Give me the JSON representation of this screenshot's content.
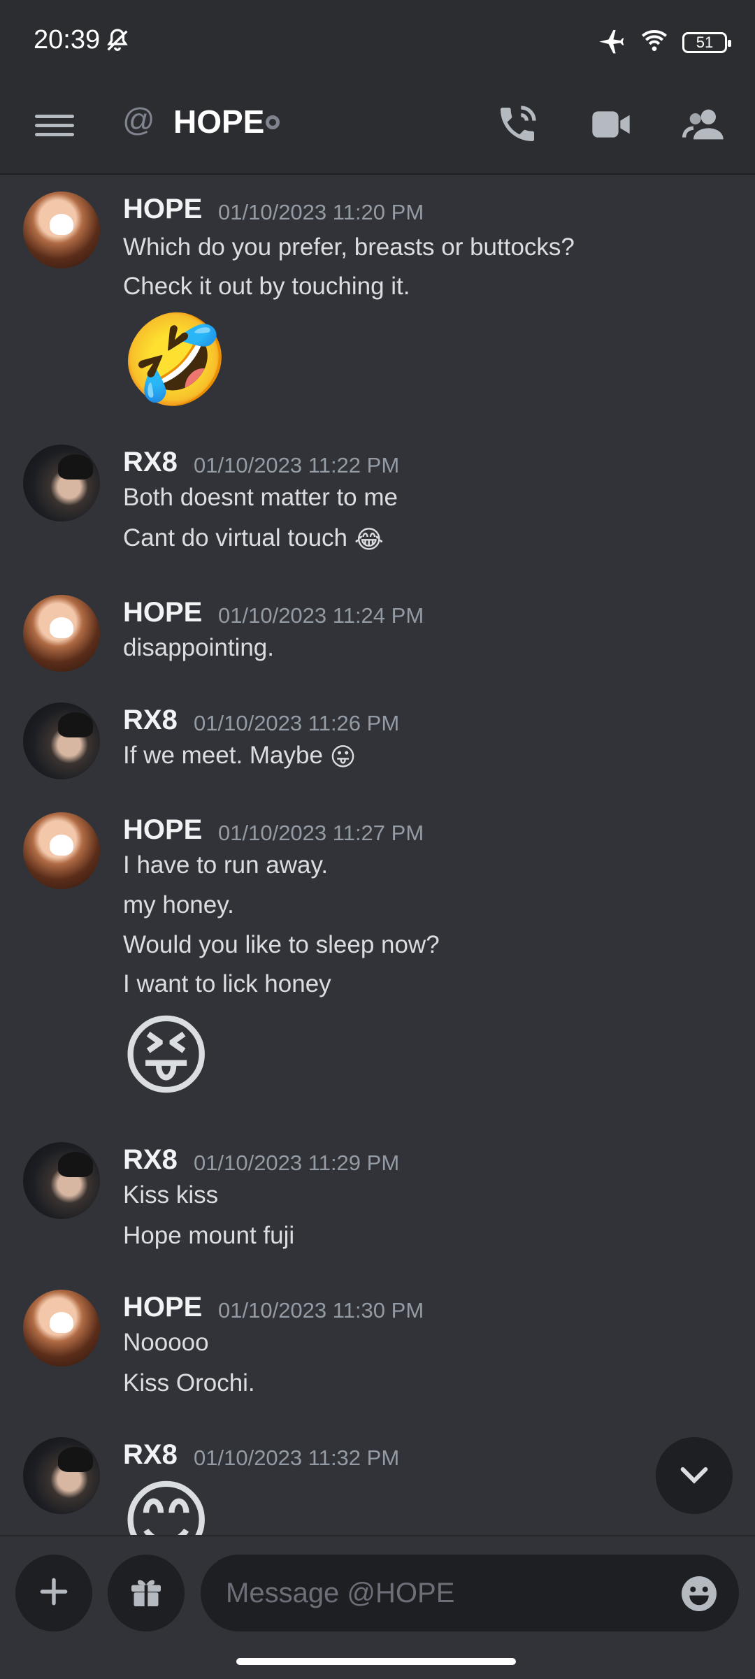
{
  "status_bar": {
    "time": "20:39",
    "battery": "51"
  },
  "header": {
    "title": "HOPE"
  },
  "messages": [
    {
      "author": "HOPE",
      "timestamp": "01/10/2023 11:20 PM",
      "lines": [
        "Which do you prefer, breasts or buttocks?",
        "Check it out by touching it."
      ],
      "big_emoji": "🤣"
    },
    {
      "author": "RX8",
      "timestamp": "01/10/2023 11:22 PM",
      "lines": [
        "Both doesnt matter to me",
        "Cant do virtual touch"
      ],
      "inline_emoji": "😂"
    },
    {
      "author": "HOPE",
      "timestamp": "01/10/2023 11:24 PM",
      "lines": [
        "disappointing."
      ]
    },
    {
      "author": "RX8",
      "timestamp": "01/10/2023 11:26 PM",
      "lines": [
        "If we meet. Maybe"
      ],
      "inline_emoji": "😛"
    },
    {
      "author": "HOPE",
      "timestamp": "01/10/2023 11:27 PM",
      "lines": [
        "I have to run away.",
        "my honey.",
        "Would you like to sleep now?",
        "I want to lick honey"
      ],
      "big_emoji": "😝"
    },
    {
      "author": "RX8",
      "timestamp": "01/10/2023 11:29 PM",
      "lines": [
        "Kiss kiss",
        "Hope mount fuji"
      ]
    },
    {
      "author": "HOPE",
      "timestamp": "01/10/2023 11:30 PM",
      "lines": [
        "Nooooo",
        "Kiss Orochi."
      ]
    },
    {
      "author": "RX8",
      "timestamp": "01/10/2023 11:32 PM",
      "lines": [],
      "big_emoji": "😊"
    }
  ],
  "composer": {
    "placeholder": "Message @HOPE"
  },
  "icons": {
    "menu": "hamburger-icon",
    "at": "at-icon",
    "call": "phone-call-icon",
    "video": "video-camera-icon",
    "members": "members-icon",
    "add": "plus-icon",
    "gift": "gift-icon",
    "emoji": "emoji-icon",
    "jump": "chevron-down-icon"
  },
  "colors": {
    "background": "#313338",
    "bar": "#2b2d31",
    "input": "#1e1f22",
    "muted": "#949ba4"
  }
}
